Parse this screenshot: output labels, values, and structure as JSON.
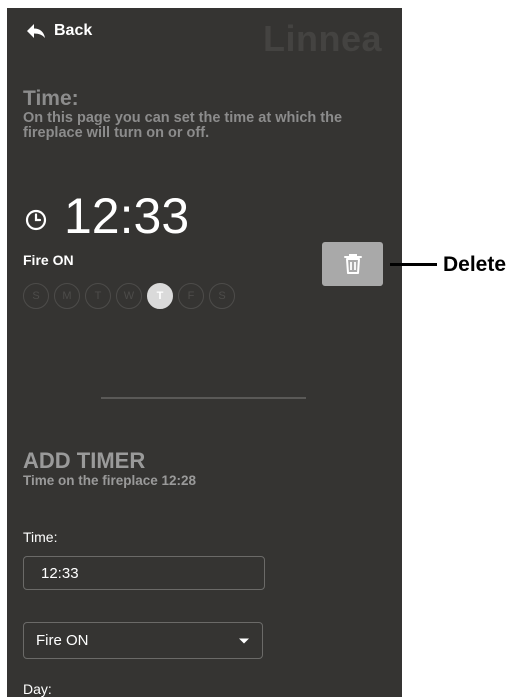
{
  "header": {
    "back_label": "Back",
    "brand": "Linnea"
  },
  "time_section": {
    "title": "Time:",
    "description": "On this page you can set the time at which the fireplace will turn on or off."
  },
  "timer": {
    "time": "12:33",
    "mode": "Fire ON",
    "days": [
      "S",
      "M",
      "T",
      "W",
      "T",
      "F",
      "S"
    ],
    "active_day_index": 4
  },
  "add_timer": {
    "title": "ADD TIMER",
    "subtitle": "Time on the fireplace 12:28",
    "time_label": "Time:",
    "time_value": "12:33",
    "mode_value": "Fire ON",
    "day_label": "Day:"
  },
  "annotation": {
    "delete_label": "Delete"
  },
  "icons": {
    "back": "back-arrow-icon",
    "clock": "clock-icon",
    "delete": "trash-icon",
    "dropdown": "caret-down-icon"
  },
  "colors": {
    "background": "#353432",
    "delete_button": "#a9a9a9",
    "active_day": "#dadada",
    "inactive_day": "#4d4c4a"
  }
}
